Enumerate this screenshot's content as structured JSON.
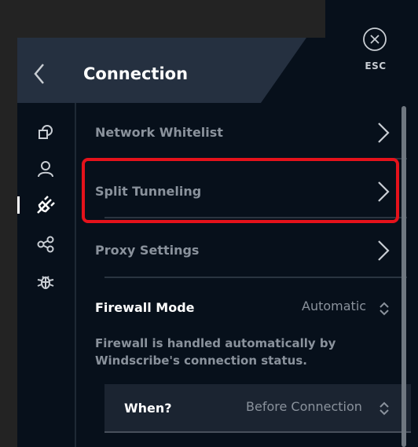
{
  "header": {
    "title": "Connection",
    "esc_label": "ESC"
  },
  "sidebar": {
    "items": [
      {
        "name": "general",
        "icon": "general-settings-icon"
      },
      {
        "name": "account",
        "icon": "account-icon"
      },
      {
        "name": "connection",
        "icon": "plug-icon",
        "active": true
      },
      {
        "name": "share",
        "icon": "share-icon"
      },
      {
        "name": "debug",
        "icon": "bug-icon"
      }
    ]
  },
  "rows": [
    {
      "label": "Network Whitelist"
    },
    {
      "label": "Split Tunneling"
    },
    {
      "label": "Proxy Settings"
    }
  ],
  "firewall": {
    "label": "Firewall Mode",
    "value": "Automatic",
    "description": "Firewall is handled automatically by Windscribe's connection status."
  },
  "when": {
    "label": "When?",
    "value": "Before Connection"
  },
  "colors": {
    "highlight": "#e5121b",
    "panel": "#07101b",
    "header": "#253040"
  }
}
